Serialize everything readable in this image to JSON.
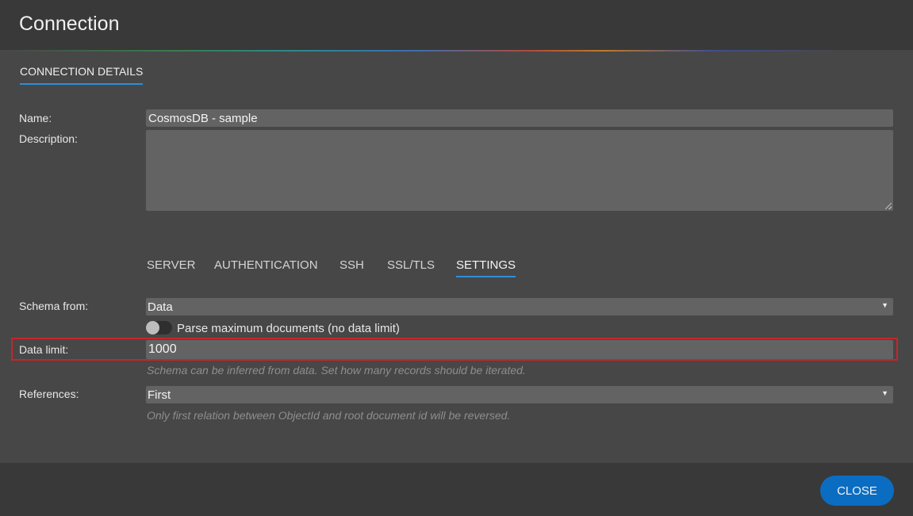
{
  "window": {
    "title": "Connection"
  },
  "main_tab": {
    "label": "CONNECTION DETAILS"
  },
  "form": {
    "name_label": "Name:",
    "name_value": "CosmosDB - sample",
    "description_label": "Description:",
    "description_value": ""
  },
  "sub_tabs": [
    {
      "label": "SERVER",
      "active": false
    },
    {
      "label": "AUTHENTICATION",
      "active": false
    },
    {
      "label": "SSH",
      "active": false
    },
    {
      "label": "SSL/TLS",
      "active": false
    },
    {
      "label": "SETTINGS",
      "active": true
    }
  ],
  "settings": {
    "schema_label": "Schema from:",
    "schema_value": "Data",
    "parse_max_label": "Parse maximum documents (no data limit)",
    "parse_max_on": false,
    "data_limit_label": "Data limit:",
    "data_limit_value": "1000",
    "data_limit_hint": "Schema can be inferred from data. Set how many records should be iterated.",
    "references_label": "References:",
    "references_value": "First",
    "references_hint": "Only first relation between ObjectId and root document id will be reversed."
  },
  "footer": {
    "close_label": "CLOSE"
  },
  "colors": {
    "accent": "#2b8fd8",
    "button": "#0a6dc2",
    "highlight": "#c9242b"
  },
  "icons": {
    "dropdown": "dropdown-arrow-icon",
    "resize": "resize-handle-icon"
  }
}
